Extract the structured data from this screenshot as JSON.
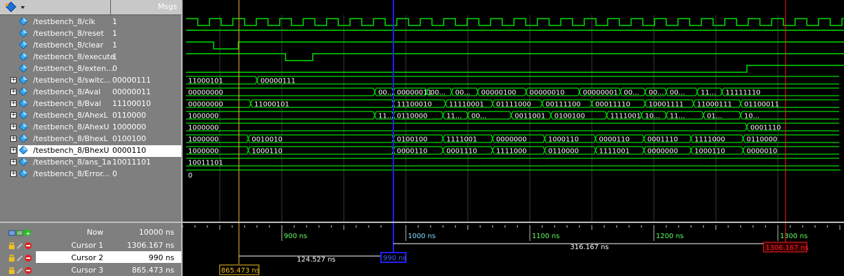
{
  "header": {
    "msgs_label": "Msgs",
    "toolbar_icon": "diamond-dropdown-icon"
  },
  "signals": [
    {
      "name": "/testbench_8/clk",
      "value": "1",
      "expandable": false
    },
    {
      "name": "/testbench_8/reset",
      "value": "1",
      "expandable": false
    },
    {
      "name": "/testbench_8/clear",
      "value": "1",
      "expandable": false
    },
    {
      "name": "/testbench_8/execute",
      "value": "1",
      "expandable": false
    },
    {
      "name": "/testbench_8/exten...",
      "value": "0",
      "expandable": false
    },
    {
      "name": "/testbench_8/switc...",
      "value": "00000111",
      "expandable": true
    },
    {
      "name": "/testbench_8/Aval",
      "value": "00000011",
      "expandable": true
    },
    {
      "name": "/testbench_8/Bval",
      "value": "11100010",
      "expandable": true
    },
    {
      "name": "/testbench_8/AhexL",
      "value": "0110000",
      "expandable": true
    },
    {
      "name": "/testbench_8/AhexU",
      "value": "1000000",
      "expandable": true
    },
    {
      "name": "/testbench_8/BhexL",
      "value": "0100100",
      "expandable": true
    },
    {
      "name": "/testbench_8/BhexU",
      "value": "0000110",
      "expandable": true,
      "selected": true
    },
    {
      "name": "/testbench_8/ans_1a",
      "value": "10011101",
      "expandable": true
    },
    {
      "name": "/testbench_8/Error...",
      "value": "0",
      "expandable": true
    }
  ],
  "bus_labels": {
    "switc": [
      "11000101",
      "00000111"
    ],
    "Aval": [
      "00000000",
      "00...",
      "00000011",
      "00...",
      "00...",
      "00000100",
      "00000010",
      "00000001",
      "00...",
      "00...",
      "00...",
      "11...",
      "11111110"
    ],
    "Bval": [
      "00000000",
      "11000101",
      "11100010",
      "11110001",
      "01111000",
      "00111100",
      "00011110",
      "10001111",
      "11000111",
      "01100011"
    ],
    "AhexL": [
      "1000000",
      "11...",
      "0110000",
      "11...",
      "00...",
      "0011001",
      "0100100",
      "1111001",
      "10...",
      "11...",
      "01...",
      "10...",
      "0000110"
    ],
    "AhexU": [
      "1000000",
      "0001110"
    ],
    "BhexL": [
      "1000000",
      "0010010",
      "0100100",
      "1111001",
      "0000000",
      "1000110",
      "0000110",
      "0001110",
      "1111000",
      "0110000"
    ],
    "BhexU": [
      "1000000",
      "1000110",
      "0000110",
      "0001110",
      "1111000",
      "0110000",
      "1111001",
      "0000000",
      "1000110",
      "0000010"
    ],
    "ans": [
      "10011101"
    ],
    "error": [
      "0"
    ]
  },
  "timeline": {
    "ticks": [
      "900 ns",
      "1000 ns",
      "1100 ns",
      "1200 ns",
      "1300 ns"
    ],
    "delta_cursor1": "316.167 ns",
    "delta_cursor2": "124.527 ns",
    "cursor1_tag": "1306.167 ns",
    "cursor2_tag": "990 ns",
    "cursor3_tag": "865.473 ns"
  },
  "bottom": {
    "now_label": "Now",
    "now_value": "10000 ns",
    "cursors": [
      {
        "label": "Cursor 1",
        "value": "1306.167 ns",
        "color": "#ff2020"
      },
      {
        "label": "Cursor 2",
        "value": "990 ns",
        "color": "#2040ff",
        "selected": true
      },
      {
        "label": "Cursor 3",
        "value": "865.473 ns",
        "color": "#f0c020"
      }
    ]
  },
  "colors": {
    "wave": "#00e000",
    "grid": "#404040",
    "cursor1": "#ff2020",
    "cursor2": "#2020ff",
    "cursor3": "#f0c020"
  }
}
